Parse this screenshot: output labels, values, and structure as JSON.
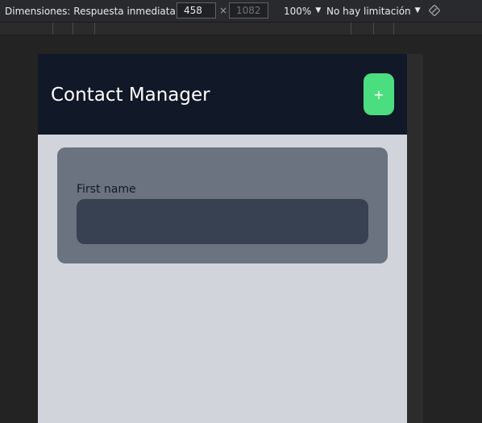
{
  "devtools": {
    "dimensions_label": "Dimensiones: Respuesta inmediata",
    "width_value": "458",
    "height_value": "1082",
    "times_symbol": "×",
    "zoom_label": "100%",
    "throttle_label": "No hay limitación",
    "caret": "▼"
  },
  "app": {
    "title": "Contact Manager",
    "add_button_label": "+",
    "form": {
      "first_name_label": "First name",
      "first_name_value": "",
      "first_name_placeholder": ""
    }
  },
  "colors": {
    "header_bg": "#111827",
    "page_bg": "#d1d5db",
    "card_bg": "#6b7280",
    "input_bg": "#374151",
    "add_button_bg": "#4ade80"
  }
}
